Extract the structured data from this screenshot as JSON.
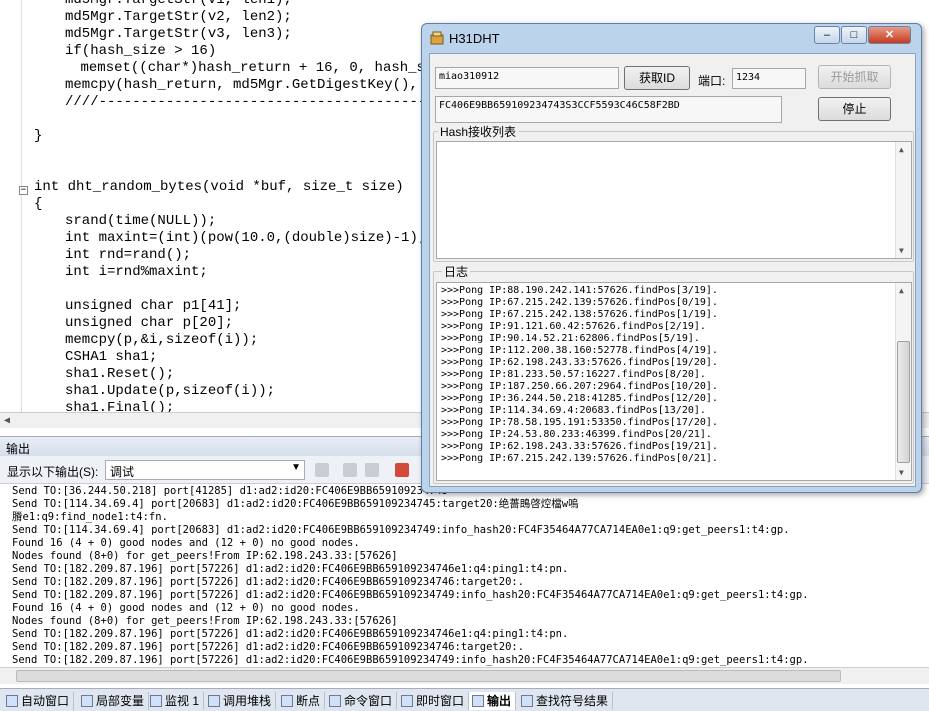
{
  "editor": {
    "lines": [
      {
        "text": "md5Mgr.TargetStr(v1, len1);",
        "indent": 2
      },
      {
        "text": "md5Mgr.TargetStr(v2, len2);",
        "indent": 2
      },
      {
        "text": "md5Mgr.TargetStr(v3, len3);",
        "indent": 2
      },
      {
        "text": "if(hash_size > 16)",
        "indent": 2
      },
      {
        "text": "memset((char*)hash_return + 16, 0, hash_s",
        "indent": 3
      },
      {
        "text": "memcpy(hash_return, md5Mgr.GetDigestKey(), ha",
        "indent": 2
      },
      {
        "text": "////-----------------------------------------",
        "indent": 2
      },
      {
        "text": "",
        "indent": 0
      },
      {
        "text": "}",
        "indent": 0
      },
      {
        "text": "",
        "indent": 0
      },
      {
        "text": "",
        "indent": 0
      },
      {
        "text": "int dht_random_bytes(void *buf, size_t size)",
        "indent": 0
      },
      {
        "text": "{",
        "indent": 0
      },
      {
        "text": "srand(time(NULL));",
        "indent": 2
      },
      {
        "text": "int maxint=(int)(pow(10.0,(double)size)-1);",
        "indent": 2
      },
      {
        "text": "int rnd=rand();",
        "indent": 2
      },
      {
        "text": "int i=rnd%maxint;",
        "indent": 2
      },
      {
        "text": "",
        "indent": 0
      },
      {
        "text": "unsigned char p1[41];",
        "indent": 2
      },
      {
        "text": "unsigned char p[20];",
        "indent": 2
      },
      {
        "text": "memcpy(p,&i,sizeof(i));",
        "indent": 2
      },
      {
        "text": "CSHA1 sha1;",
        "indent": 2
      },
      {
        "text": "sha1.Reset();",
        "indent": 2
      },
      {
        "text": "sha1.Update(p,sizeof(i));",
        "indent": 2
      },
      {
        "text": "sha1.Final();",
        "indent": 2
      }
    ]
  },
  "output_panel": {
    "title": "输出",
    "show_output_label": "显示以下输出(S):",
    "source_value": "调试",
    "lines": [
      "Send TO:[36.244.50.218] port[41285] d1:ad2:id20:FC406E9BB659109234745",
      "Send TO:[114.34.69.4] port[20683] d1:ad2:id20:FC406E9BB659109234745:target20:绝薔鵖啓焢檔w嗚",
      "膌e1:q9:find_node1:t4:fn.",
      "Send TO:[114.34.69.4] port[20683] d1:ad2:id20:FC406E9BB659109234749:info_hash20:FC4F35464A77CA714EA0e1:q9:get_peers1:t4:gp.",
      "Found 16 (4 + 0) good nodes and (12 + 0) no good nodes.",
      "Nodes found (8+0) for get_peers!From IP:62.198.243.33:[57626]",
      "Send TO:[182.209.87.196] port[57226] d1:ad2:id20:FC406E9BB659109234746e1:q4:ping1:t4:pn.",
      "Send TO:[182.209.87.196] port[57226] d1:ad2:id20:FC406E9BB659109234746:target20:.",
      "Send TO:[182.209.87.196] port[57226] d1:ad2:id20:FC406E9BB659109234749:info_hash20:FC4F35464A77CA714EA0e1:q9:get_peers1:t4:gp.",
      "Found 16 (4 + 0) good nodes and (12 + 0) no good nodes.",
      "Nodes found (8+0) for get_peers!From IP:62.198.243.33:[57626]",
      "Send TO:[182.209.87.196] port[57226] d1:ad2:id20:FC406E9BB659109234746e1:q4:ping1:t4:pn.",
      "Send TO:[182.209.87.196] port[57226] d1:ad2:id20:FC406E9BB659109234746:target20:.",
      "Send TO:[182.209.87.196] port[57226] d1:ad2:id20:FC406E9BB659109234749:info_hash20:FC4F35464A77CA714EA0e1:q9:get_peers1:t4:gp."
    ]
  },
  "bottom_tabs": [
    {
      "label": "自动窗口",
      "active": false
    },
    {
      "label": "局部变量",
      "active": false
    },
    {
      "label": "监视 1",
      "active": false
    },
    {
      "label": "调用堆栈",
      "active": false
    },
    {
      "label": "断点",
      "active": false
    },
    {
      "label": "命令窗口",
      "active": false
    },
    {
      "label": "即时窗口",
      "active": false
    },
    {
      "label": "输出",
      "active": true
    },
    {
      "label": "查找符号结果",
      "active": false
    }
  ],
  "dialog": {
    "title": "H31DHT",
    "minimize": "–",
    "maximize": "□",
    "close": "✕",
    "id_value": "miao310912",
    "get_id_button": "获取ID",
    "port_label": "端口:",
    "port_value": "1234",
    "start_button": "开始抓取",
    "hash_value": "FC406E9BB659109234743S3CCF5593C46C58F2BD",
    "stop_button": "停止",
    "hash_list_label": "Hash接收列表",
    "log_label": "日志",
    "log_lines": [
      ">>>Pong IP:88.190.242.141:57626.findPos[3/19].",
      ">>>Pong IP:67.215.242.139:57626.findPos[0/19].",
      ">>>Pong IP:67.215.242.138:57626.findPos[1/19].",
      ">>>Pong IP:91.121.60.42:57626.findPos[2/19].",
      ">>>Pong IP:90.14.52.21:62806.findPos[5/19].",
      ">>>Pong IP:112.200.38.160:52778.findPos[4/19].",
      ">>>Pong IP:62.198.243.33:57626.findPos[19/20].",
      ">>>Pong IP:81.233.50.57:16227.findPos[8/20].",
      ">>>Pong IP:187.250.66.207:2964.findPos[10/20].",
      ">>>Pong IP:36.244.50.218:41285.findPos[12/20].",
      ">>>Pong IP:114.34.69.4:20683.findPos[13/20].",
      ">>>Pong IP:78.58.195.191:53350.findPos[17/20].",
      ">>>Pong IP:24.53.80.233:46399.findPos[20/21].",
      ">>>Pong IP:62.198.243.33:57626.findPos[19/21].",
      ">>>Pong IP:67.215.242.139:57626.findPos[0/21]."
    ]
  },
  "colors": {
    "keyword": "#0000ff",
    "dialog_frame": "#bcd3ec",
    "close_button": "#c63a1f"
  }
}
